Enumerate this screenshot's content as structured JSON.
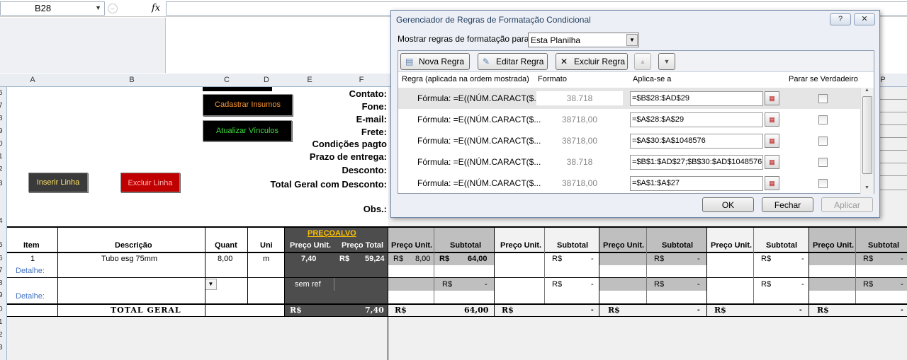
{
  "formula_bar": {
    "name_box": "B28",
    "fx": "fx",
    "formula": ""
  },
  "columns": [
    "A",
    "B",
    "C",
    "D",
    "E",
    "F",
    "P"
  ],
  "rows": [
    "6",
    "7",
    "8",
    "9",
    "0",
    "1",
    "2",
    "3",
    "4",
    "5",
    "6",
    "7",
    "8",
    "9",
    "0",
    "1",
    "2",
    "3"
  ],
  "sheet": {
    "buttons": {
      "cadastrar": "Cadastrar Insumos",
      "atualizar": "Atualizar Vínculos",
      "inserir": "Inserir Linha",
      "excluir": "Excluir Linha"
    },
    "labels": {
      "contato": "Contato:",
      "fone": "Fone:",
      "email": "E-mail:",
      "frete": "Frete:",
      "condicoes": "Condições pagto",
      "prazo": "Prazo de entrega:",
      "desconto": "Desconto:",
      "total_desc": "Total Geral com Desconto:",
      "obs": "Obs.:"
    },
    "table_header": {
      "item": "Item",
      "descricao": "Descrição",
      "quant": "Quant",
      "uni": "Uni",
      "preco_link": "PREÇO",
      "alvo_link": "ALVO",
      "preco_unit": "Preço Unit.",
      "preco_total": "Preço Total",
      "subtotal": "Subtotal"
    },
    "row1": {
      "item": "1",
      "descricao": "Tubo esg 75mm",
      "quant": "8,00",
      "uni": "m",
      "preco_unit": "7,40",
      "rs": "R$",
      "preco_total": "59,24",
      "f1_unit_rs": "R$",
      "f1_unit": "8,00",
      "f1_sub_rs": "R$",
      "f1_sub": "64,00",
      "dash_rs": "R$",
      "dash": "-"
    },
    "detalhe": "Detalhe:",
    "sem_ref": "sem ref",
    "total_geral": "TOTAL GERAL",
    "totals": {
      "rs": "R$",
      "alvo": "7,40",
      "f1": "64,00",
      "dash": "-"
    }
  },
  "dialog": {
    "title": "Gerenciador de Regras de Formatação Condicional",
    "help": "?",
    "close": "✕",
    "show_label": "Mostrar regras de formatação para:",
    "show_value": "Esta Planilha",
    "toolbar": {
      "new_rule": "Nova Regra",
      "edit_rule": "Editar Regra",
      "delete_rule": "Excluir Regra"
    },
    "columns": {
      "rule": "Regra (aplicada na ordem mostrada)",
      "format": "Formato",
      "applies": "Aplica-se a",
      "stop": "Parar se Verdadeiro"
    },
    "rules": [
      {
        "rule": "Fórmula: =E((NÚM.CARACT($...",
        "format": "38.718",
        "applies": "=$B$28:$AD$29"
      },
      {
        "rule": "Fórmula: =E((NÚM.CARACT($...",
        "format": "38718,00",
        "applies": "=$A$28:$A$29"
      },
      {
        "rule": "Fórmula: =E((NÚM.CARACT($...",
        "format": "38718,00",
        "applies": "=$A$30:$A$1048576"
      },
      {
        "rule": "Fórmula: =E((NÚM.CARACT($...",
        "format": "38.718",
        "applies": "=$B$1:$AD$27;$B$30:$AD$1048576"
      },
      {
        "rule": "Fórmula: =E((NÚM.CARACT($...",
        "format": "38718,00",
        "applies": "=$A$1:$A$27"
      }
    ],
    "ok": "OK",
    "close_btn": "Fechar",
    "apply": "Aplicar"
  }
}
